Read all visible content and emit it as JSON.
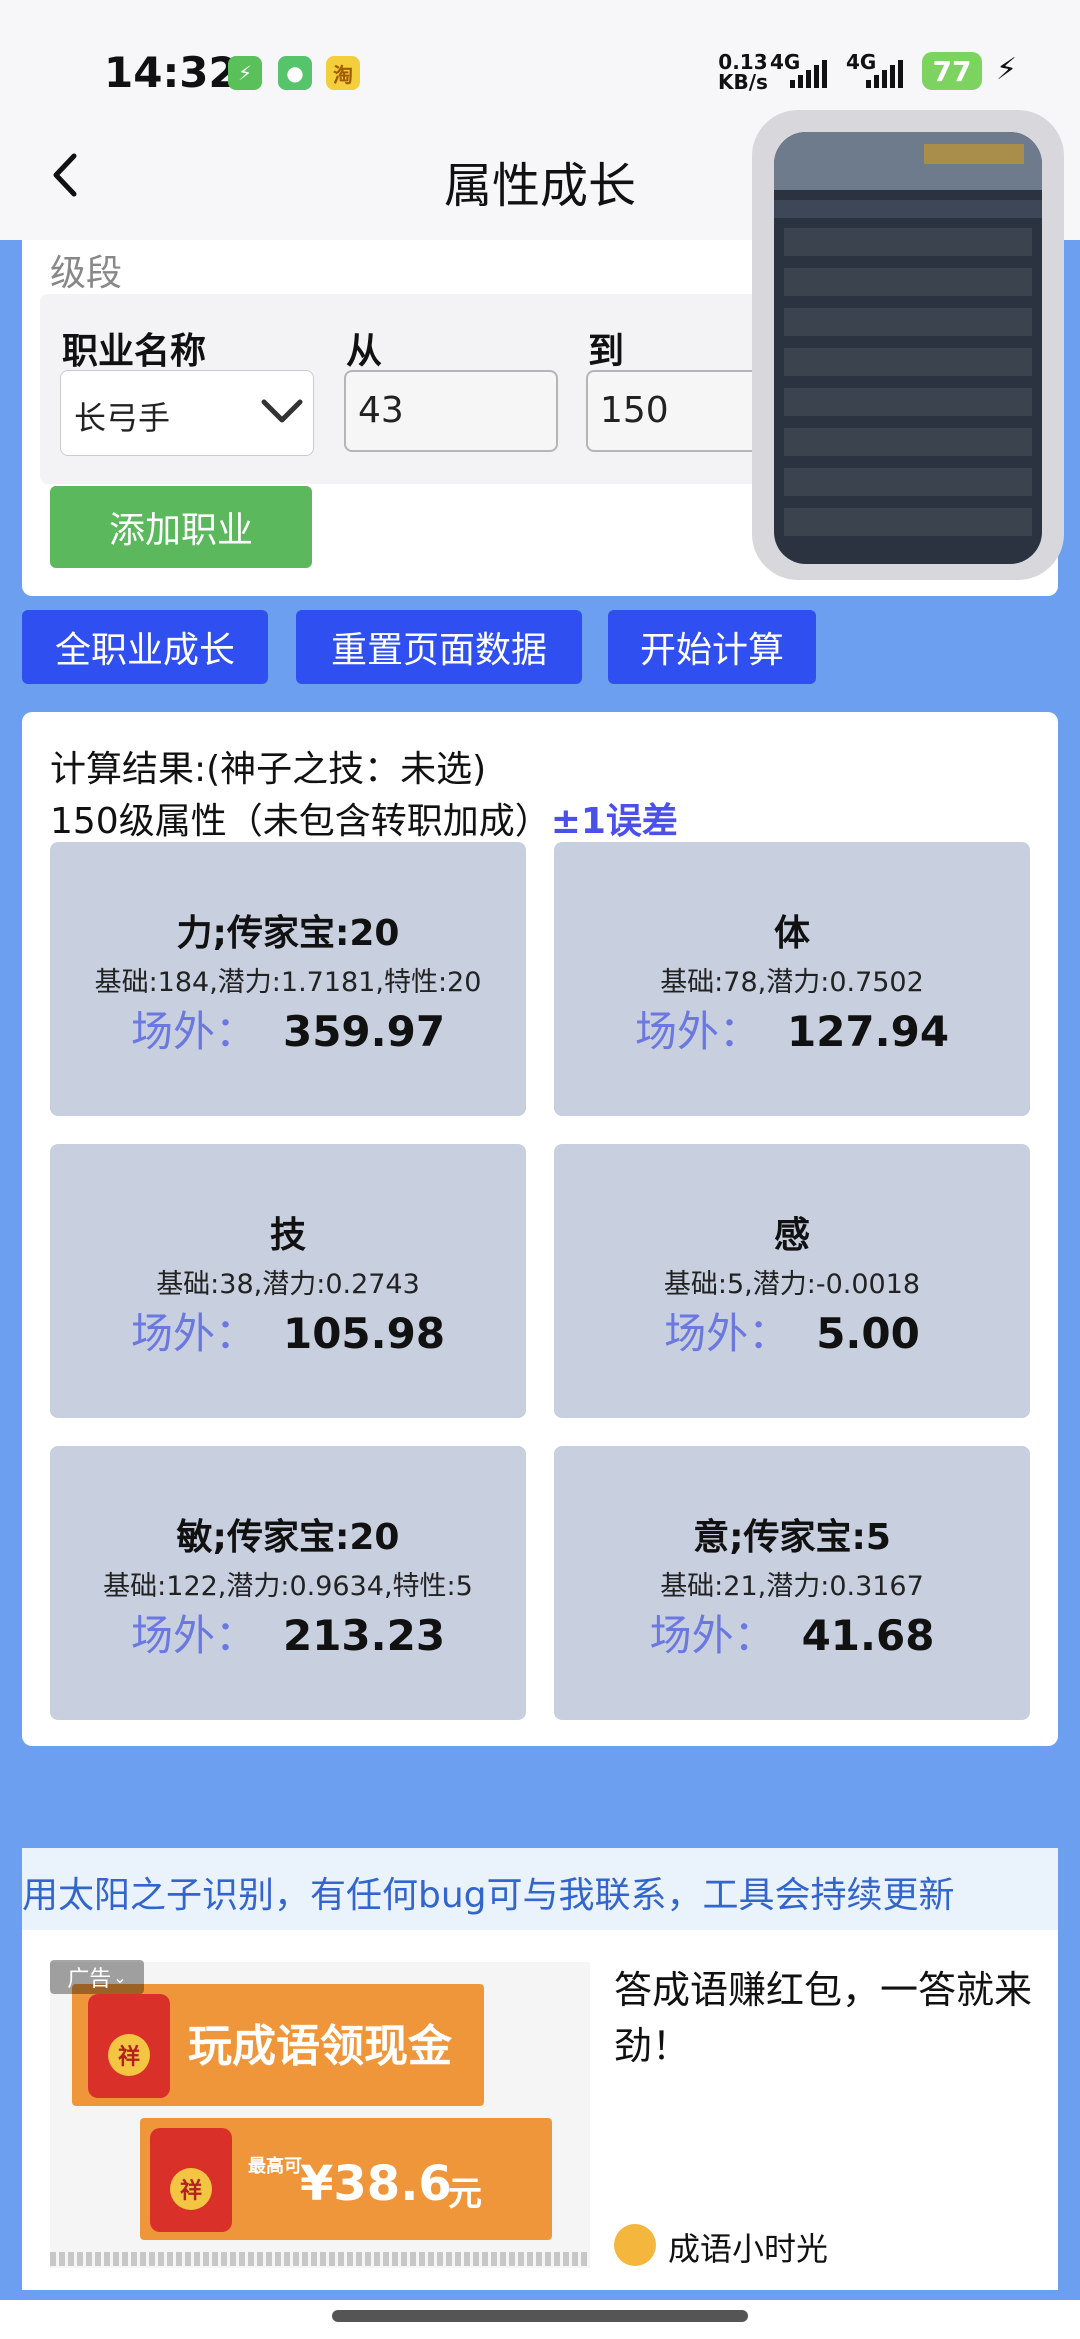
{
  "status_bar": {
    "time": "14:32",
    "app_icons": [
      {
        "name": "charge-app-icon",
        "glyph": "⚡",
        "color": "#5ac05a"
      },
      {
        "name": "message-app-icon",
        "glyph": "💬",
        "color": "#55c46a"
      },
      {
        "name": "taobao-app-icon",
        "glyph": "淘",
        "color": "#f3cf3c"
      }
    ],
    "net_speed_value": "0.13",
    "net_speed_unit": "KB/s",
    "signal1": "4G",
    "signal2": "4G",
    "battery": "77"
  },
  "header": {
    "title": "属性成长"
  },
  "form": {
    "section_label": "级段",
    "job_label": "职业名称",
    "job_value": "长弓手",
    "from_label": "从",
    "from_value": "43",
    "to_label": "到",
    "to_value": "150",
    "add_job_button": "添加职业"
  },
  "actions": {
    "all_jobs_button": "全职业成长",
    "reset_button": "重置页面数据",
    "calculate_button": "开始计算"
  },
  "results": {
    "line1": "计算结果:(神子之技：未选)",
    "line2": "150级属性（未包含转职加成）",
    "error_note": "±1误差",
    "outside_label": "场外：",
    "stats": [
      {
        "title": "力;传家宝:20",
        "detail": "基础:184,潜力:1.7181,特性:20",
        "value": "359.97"
      },
      {
        "title": "体",
        "detail": "基础:78,潜力:0.7502",
        "value": "127.94"
      },
      {
        "title": "技",
        "detail": "基础:38,潜力:0.2743",
        "value": "105.98"
      },
      {
        "title": "感",
        "detail": "基础:5,潜力:-0.0018",
        "value": "5.00"
      },
      {
        "title": "敏;传家宝:20",
        "detail": "基础:122,潜力:0.9634,特性:5",
        "value": "213.23"
      },
      {
        "title": "意;传家宝:5",
        "detail": "基础:21,潜力:0.3167",
        "value": "41.68"
      }
    ]
  },
  "marquee": "用太阳之子识别，有任何bug可与我联系，工具会持续更新",
  "ad": {
    "tag": "广告",
    "banner1": "玩成语领现金",
    "seal": "祥",
    "max_label": "最高可",
    "amount": "¥38.6",
    "unit": "元",
    "text": "答成语赚红包，一答就来劲！",
    "advertiser": "成语小时光"
  }
}
